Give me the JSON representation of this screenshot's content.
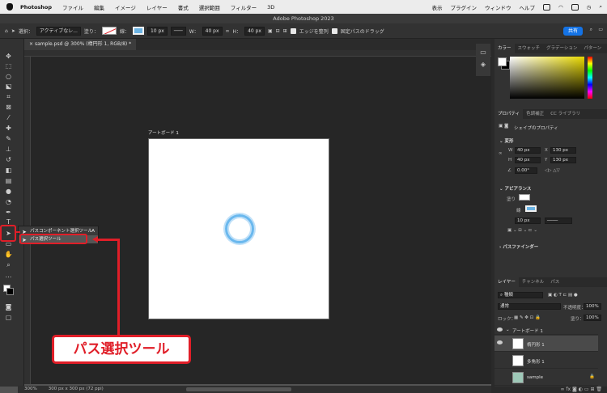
{
  "menubar": {
    "app_name": "Photoshop",
    "items": [
      "ファイル",
      "編集",
      "イメージ",
      "レイヤー",
      "書式",
      "選択範囲",
      "フィルター",
      "3D"
    ],
    "right_items": [
      "表示",
      "プラグイン",
      "ウィンドウ",
      "ヘルプ"
    ]
  },
  "window": {
    "title": "Adobe Photoshop 2023"
  },
  "options_bar": {
    "select_label": "選択：",
    "select_value": "アクティブなレ...",
    "fill_label": "塗り：",
    "stroke_label": "線：",
    "stroke_width": "10 px",
    "w_label": "W：",
    "w_value": "40 px",
    "h_label": "H：",
    "h_value": "40 px",
    "align_edges": "エッジを整列",
    "fixed_path": "固定パスのドラッグ",
    "share_button": "共有"
  },
  "document": {
    "tab_title": "sample.psd @ 300% (楕円形 1, RGB/8) *",
    "artboard_label": "アートボード 1",
    "zoom": "300%",
    "doc_size": "300 px x 300 px (72 ppi)"
  },
  "flyout": {
    "items": [
      {
        "label": "パスコンポーネント選択ツール",
        "key": "A"
      },
      {
        "label": "パス選択ツール",
        "key": ""
      }
    ]
  },
  "callout": {
    "text": "パス選択ツール"
  },
  "color_panel": {
    "tabs": [
      "カラー",
      "スウォッチ",
      "グラデーション",
      "パターン"
    ]
  },
  "properties_panel": {
    "tabs": [
      "プロパティ",
      "色調補正",
      "CC ライブラリ"
    ],
    "shape_props": "シェイプのプロパティ",
    "transform": "変形",
    "w_label": "W",
    "w_value": "40 px",
    "x_label": "X",
    "x_value": "130 px",
    "h_label": "H",
    "h_value": "40 px",
    "y_label": "Y",
    "y_value": "130 px",
    "angle_value": "0.00°",
    "appearance": "アピアランス",
    "fill_label": "塗り",
    "stroke_label": "線",
    "stroke_size": "10 px",
    "pathfinder": "パスファインダー"
  },
  "layers_panel": {
    "tabs": [
      "レイヤー",
      "チャンネル",
      "パス"
    ],
    "filter_label": "種類",
    "blend_mode": "通常",
    "opacity_label": "不透明度：",
    "opacity_value": "100%",
    "lock_label": "ロック：",
    "fill_label": "塗り：",
    "fill_value": "100%",
    "layers": [
      {
        "name": "アートボード 1",
        "selected": false
      },
      {
        "name": "楕円形 1",
        "selected": true
      },
      {
        "name": "多角形 1",
        "selected": false
      },
      {
        "name": "sample",
        "selected": false
      }
    ]
  },
  "colors": {
    "accent": "#1473e6",
    "annotation_red": "#e01e28",
    "ring_blue": "#6ab8ee"
  }
}
